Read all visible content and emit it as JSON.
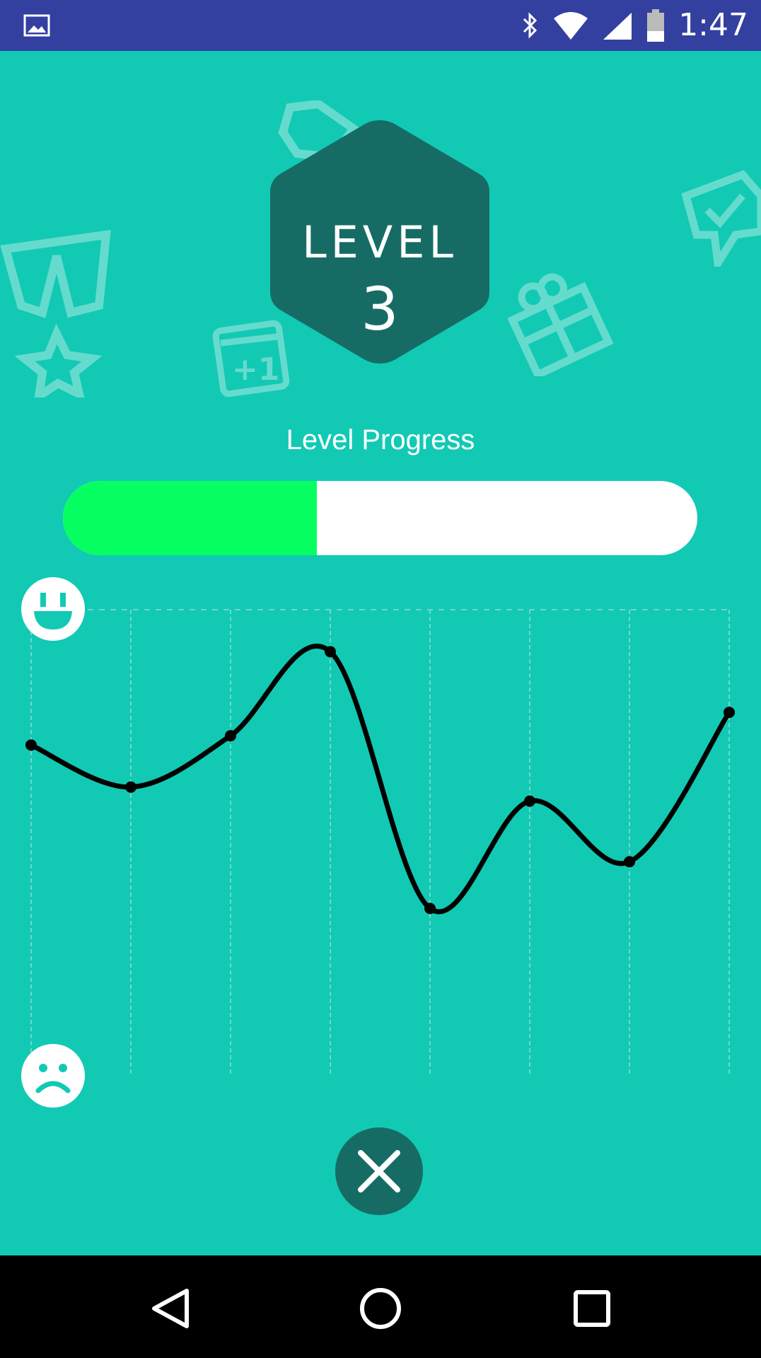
{
  "status_bar": {
    "time": "1:47",
    "icons": [
      "image-icon",
      "bluetooth-icon",
      "wifi-icon",
      "signal-icon",
      "battery-icon"
    ]
  },
  "level_badge": {
    "label": "LEVEL",
    "number": "3"
  },
  "progress": {
    "label": "Level Progress",
    "fraction": 0.4,
    "fill_color": "#06FF61",
    "track_color": "#FFFFFF"
  },
  "mood_chart": {
    "top_icon": "happy-face-icon",
    "bottom_icon": "sad-face-icon"
  },
  "chart_data": {
    "type": "line",
    "x": [
      1,
      2,
      3,
      4,
      5,
      6,
      7,
      8
    ],
    "values": [
      0.71,
      0.62,
      0.73,
      0.91,
      0.36,
      0.59,
      0.46,
      0.78
    ],
    "ylim": [
      0,
      1
    ],
    "grid": "vertical dashed",
    "line_color": "#000000",
    "title": "",
    "xlabel": "",
    "ylabel": ""
  },
  "actions": {
    "close_icon": "close-icon"
  },
  "nav_bar": {
    "back_icon": "back-triangle-icon",
    "home_icon": "home-circle-icon",
    "recents_icon": "recents-square-icon"
  },
  "colors": {
    "background": "#12C9B4",
    "status_bar": "#3340A0",
    "badge": "#166C65",
    "accent_green": "#06FF61"
  }
}
